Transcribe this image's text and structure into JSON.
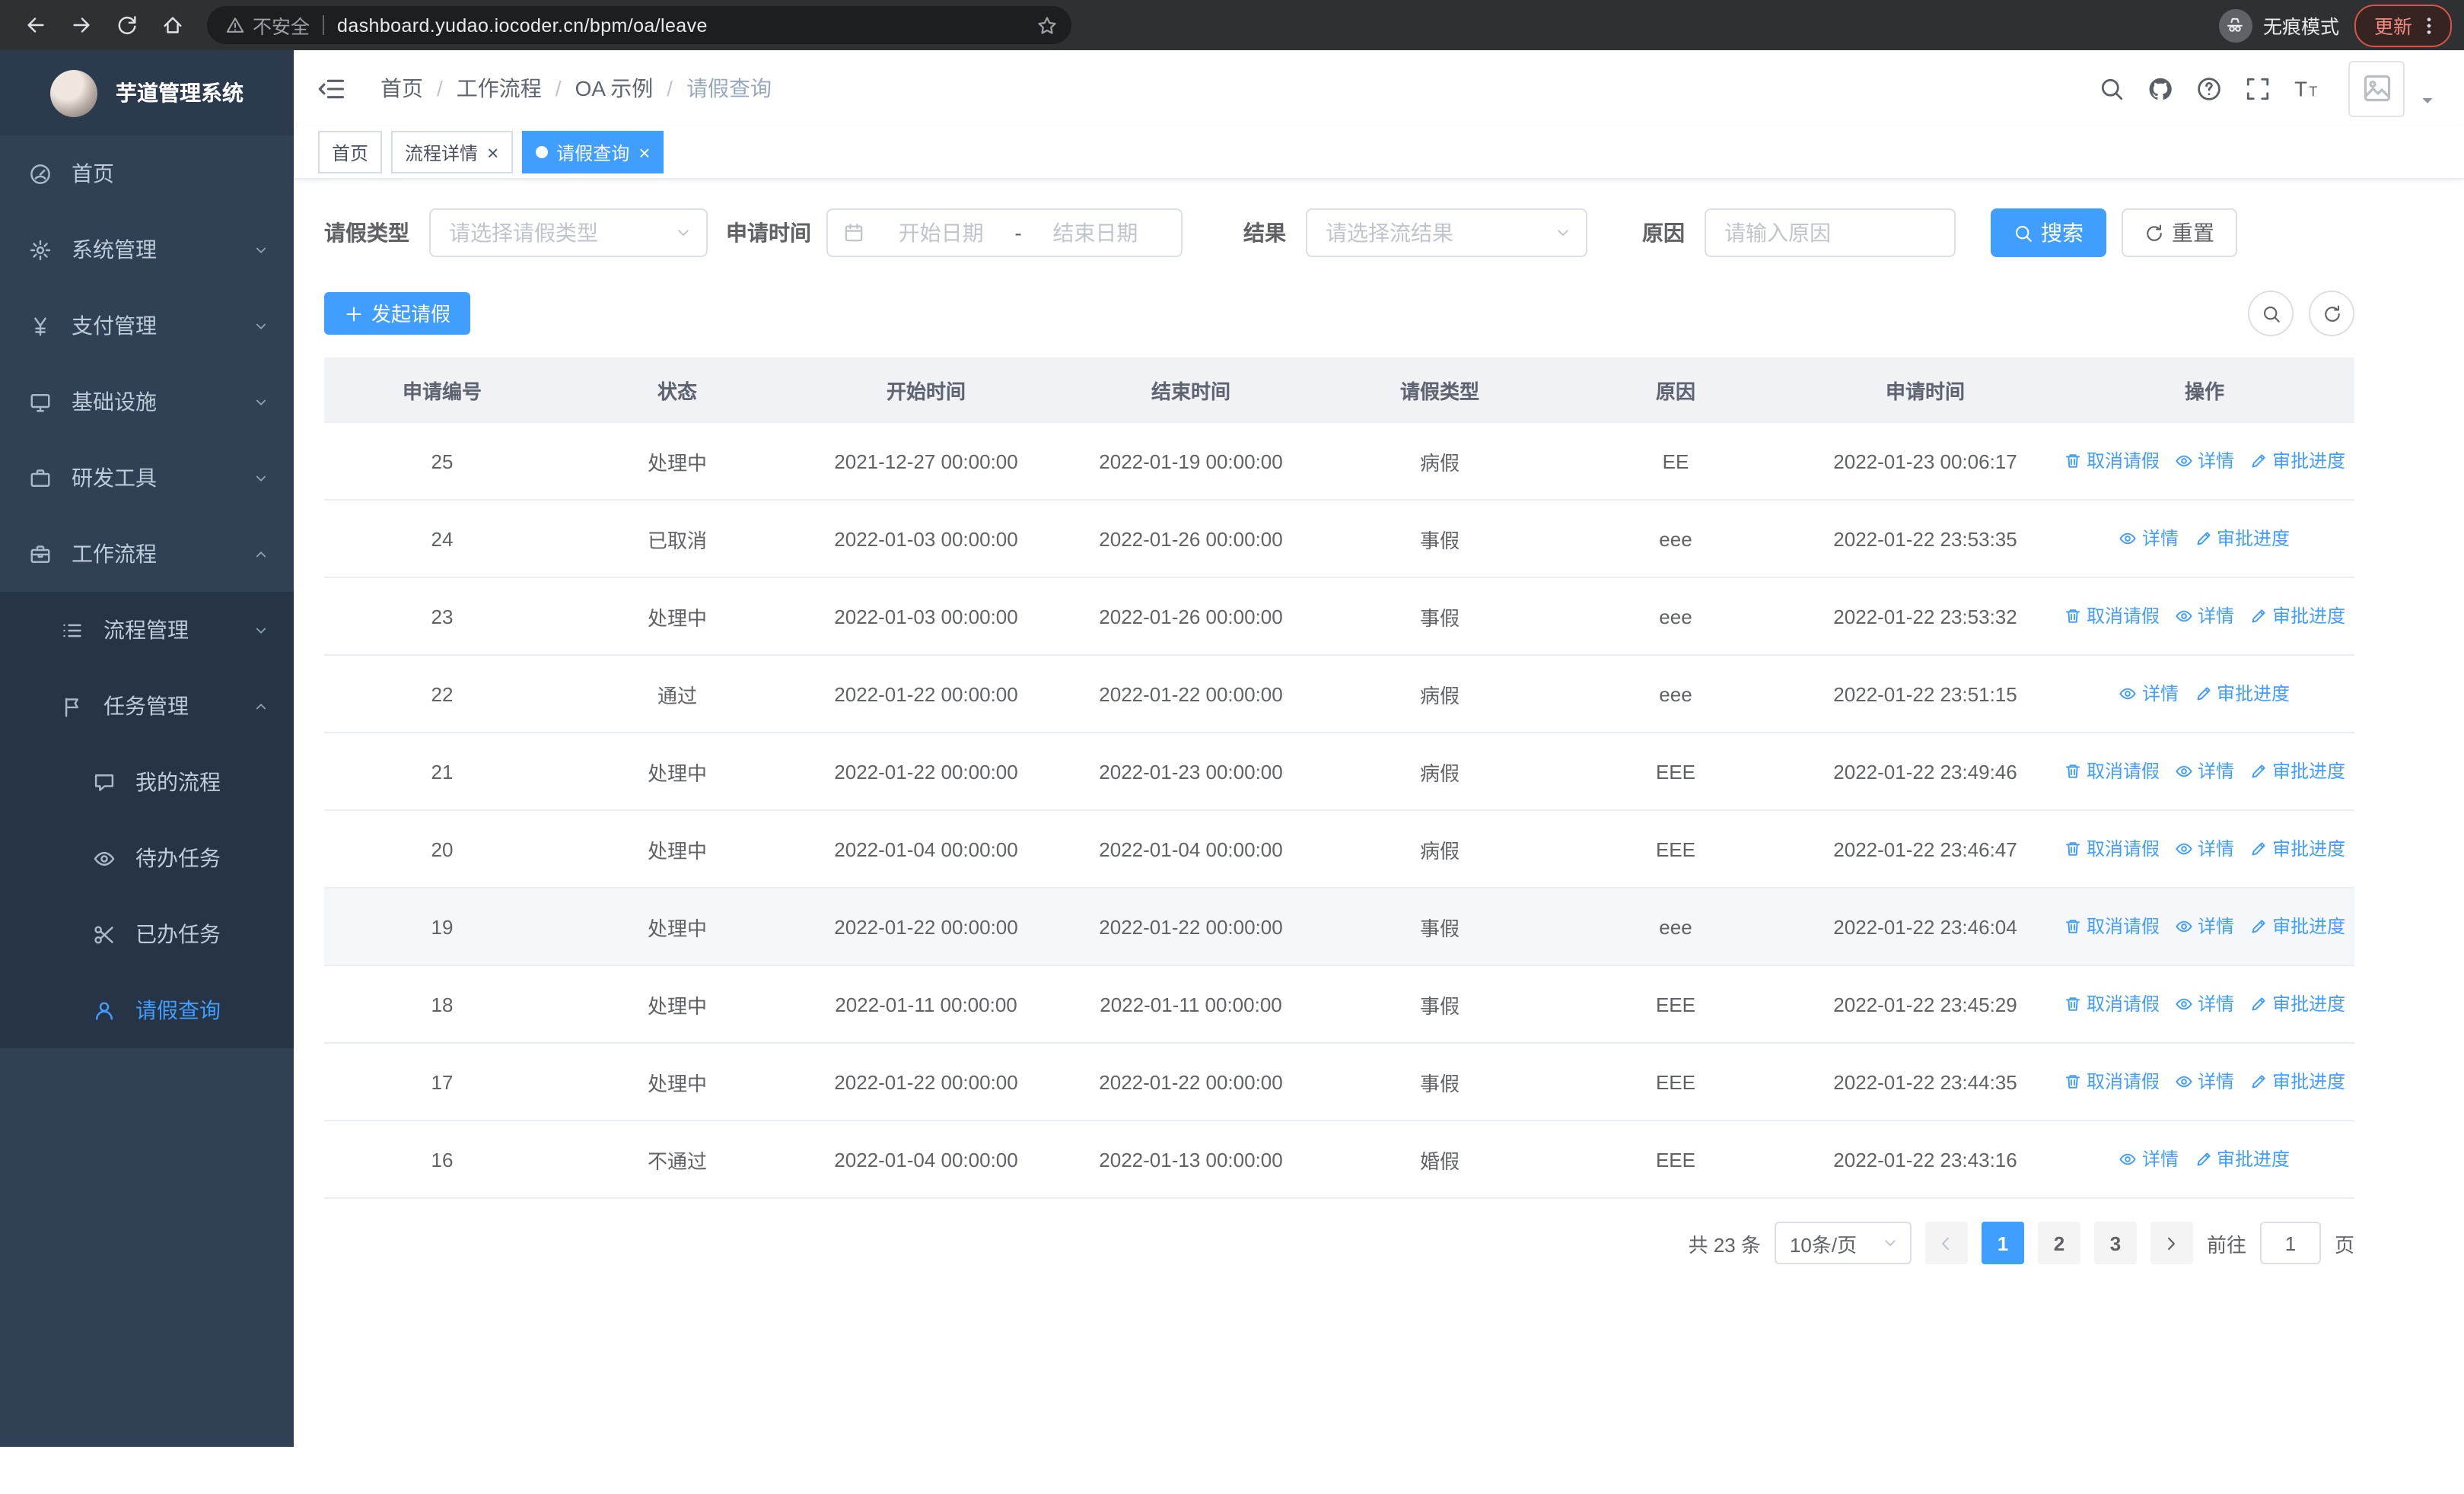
{
  "colors": {
    "accent": "#409eff",
    "sidebar_bg": "#304156",
    "submenu_bg": "#263445",
    "chrome_bg": "#2f3034",
    "update_red": "#f28b82"
  },
  "browser": {
    "security_label": "不安全",
    "url": "dashboard.yudao.iocoder.cn/bpm/oa/leave",
    "incognito_label": "无痕模式",
    "update_label": "更新"
  },
  "sidebar": {
    "logo_title": "芋道管理系统",
    "menu": [
      {
        "label": "首页",
        "icon": "dashboard-icon",
        "level": 1
      },
      {
        "label": "系统管理",
        "icon": "gear-icon",
        "level": 1,
        "chevron": "down"
      },
      {
        "label": "支付管理",
        "icon": "yen-icon",
        "level": 1,
        "chevron": "down"
      },
      {
        "label": "基础设施",
        "icon": "monitor-icon",
        "level": 1,
        "chevron": "down"
      },
      {
        "label": "研发工具",
        "icon": "toolbox-icon",
        "level": 1,
        "chevron": "down"
      },
      {
        "label": "工作流程",
        "icon": "briefcase-icon",
        "level": 1,
        "chevron": "up"
      },
      {
        "label": "流程管理",
        "icon": "list-icon",
        "level": 2,
        "chevron": "down"
      },
      {
        "label": "任务管理",
        "icon": "flag-icon",
        "level": 2,
        "chevron": "up"
      },
      {
        "label": "我的流程",
        "icon": "chat-icon",
        "level": 3
      },
      {
        "label": "待办任务",
        "icon": "eye-icon",
        "level": 3
      },
      {
        "label": "已办任务",
        "icon": "scissors-icon",
        "level": 3
      },
      {
        "label": "请假查询",
        "icon": "user-icon",
        "level": 3,
        "active": true
      }
    ]
  },
  "navbar": {
    "breadcrumb": [
      "首页",
      "工作流程",
      "OA 示例",
      "请假查询"
    ],
    "separator": "/"
  },
  "tabs": [
    {
      "label": "首页",
      "closable": false,
      "active": false
    },
    {
      "label": "流程详情",
      "closable": true,
      "active": false
    },
    {
      "label": "请假查询",
      "closable": true,
      "active": true
    }
  ],
  "filters": {
    "leave_type_label": "请假类型",
    "leave_type_placeholder": "请选择请假类型",
    "apply_time_label": "申请时间",
    "start_date_placeholder": "开始日期",
    "end_date_placeholder": "结束日期",
    "range_separator": "-",
    "result_label": "结果",
    "result_placeholder": "请选择流结果",
    "reason_label": "原因",
    "reason_placeholder": "请输入原因",
    "search_label": "搜索",
    "reset_label": "重置"
  },
  "toolbar": {
    "create_label": "发起请假"
  },
  "action_defs": {
    "cancel": {
      "label": "取消请假",
      "icon": "delete-icon"
    },
    "detail": {
      "label": "详情",
      "icon": "view-icon"
    },
    "audit": {
      "label": "审批进度",
      "icon": "edit-icon"
    }
  },
  "table": {
    "columns": [
      "申请编号",
      "状态",
      "开始时间",
      "结束时间",
      "请假类型",
      "原因",
      "申请时间",
      "操作"
    ],
    "rows": [
      {
        "id": "25",
        "status": "处理中",
        "start": "2021-12-27 00:00:00",
        "end": "2022-01-19 00:00:00",
        "type": "病假",
        "reason": "EE",
        "apply_time": "2022-01-23 00:06:17",
        "actions": [
          "cancel",
          "detail",
          "audit"
        ]
      },
      {
        "id": "24",
        "status": "已取消",
        "start": "2022-01-03 00:00:00",
        "end": "2022-01-26 00:00:00",
        "type": "事假",
        "reason": "eee",
        "apply_time": "2022-01-22 23:53:35",
        "actions": [
          "detail",
          "audit"
        ]
      },
      {
        "id": "23",
        "status": "处理中",
        "start": "2022-01-03 00:00:00",
        "end": "2022-01-26 00:00:00",
        "type": "事假",
        "reason": "eee",
        "apply_time": "2022-01-22 23:53:32",
        "actions": [
          "cancel",
          "detail",
          "audit"
        ]
      },
      {
        "id": "22",
        "status": "通过",
        "start": "2022-01-22 00:00:00",
        "end": "2022-01-22 00:00:00",
        "type": "病假",
        "reason": "eee",
        "apply_time": "2022-01-22 23:51:15",
        "actions": [
          "detail",
          "audit"
        ]
      },
      {
        "id": "21",
        "status": "处理中",
        "start": "2022-01-22 00:00:00",
        "end": "2022-01-23 00:00:00",
        "type": "病假",
        "reason": "EEE",
        "apply_time": "2022-01-22 23:49:46",
        "actions": [
          "cancel",
          "detail",
          "audit"
        ]
      },
      {
        "id": "20",
        "status": "处理中",
        "start": "2022-01-04 00:00:00",
        "end": "2022-01-04 00:00:00",
        "type": "病假",
        "reason": "EEE",
        "apply_time": "2022-01-22 23:46:47",
        "actions": [
          "cancel",
          "detail",
          "audit"
        ]
      },
      {
        "id": "19",
        "status": "处理中",
        "start": "2022-01-22 00:00:00",
        "end": "2022-01-22 00:00:00",
        "type": "事假",
        "reason": "eee",
        "apply_time": "2022-01-22 23:46:04",
        "actions": [
          "cancel",
          "detail",
          "audit"
        ],
        "highlighted": true
      },
      {
        "id": "18",
        "status": "处理中",
        "start": "2022-01-11 00:00:00",
        "end": "2022-01-11 00:00:00",
        "type": "事假",
        "reason": "EEE",
        "apply_time": "2022-01-22 23:45:29",
        "actions": [
          "cancel",
          "detail",
          "audit"
        ]
      },
      {
        "id": "17",
        "status": "处理中",
        "start": "2022-01-22 00:00:00",
        "end": "2022-01-22 00:00:00",
        "type": "事假",
        "reason": "EEE",
        "apply_time": "2022-01-22 23:44:35",
        "actions": [
          "cancel",
          "detail",
          "audit"
        ]
      },
      {
        "id": "16",
        "status": "不通过",
        "start": "2022-01-04 00:00:00",
        "end": "2022-01-13 00:00:00",
        "type": "婚假",
        "reason": "EEE",
        "apply_time": "2022-01-22 23:43:16",
        "actions": [
          "detail",
          "audit"
        ]
      }
    ]
  },
  "pagination": {
    "total": "共 23 条",
    "page_size": "10条/页",
    "pages": [
      {
        "label": "1",
        "active": true
      },
      {
        "label": "2"
      },
      {
        "label": "3"
      }
    ],
    "goto_label": "前往",
    "goto_value": "1",
    "page_suffix": "页"
  }
}
